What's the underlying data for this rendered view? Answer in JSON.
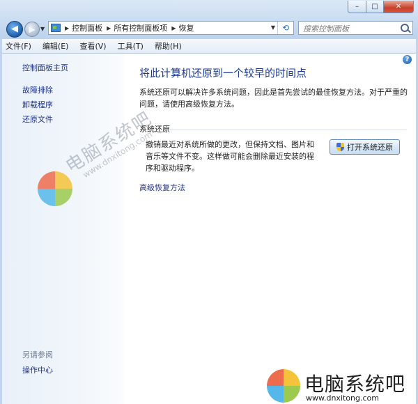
{
  "window": {
    "caption_min": "–",
    "caption_max": "□",
    "caption_close": "✕"
  },
  "address": {
    "crumbs": [
      "控制面板",
      "所有控制面板项",
      "恢复"
    ]
  },
  "search": {
    "placeholder": "搜索控制面板"
  },
  "menu": {
    "items": [
      "文件(F)",
      "编辑(E)",
      "查看(V)",
      "工具(T)",
      "帮助(H)"
    ]
  },
  "sidebar": {
    "home": "控制面板主页",
    "links": [
      "故障排除",
      "卸载程序",
      "还原文件"
    ],
    "see_also_header": "另请参阅",
    "see_also_links": [
      "操作中心"
    ]
  },
  "watermark": {
    "main": "电脑系统吧",
    "url": "www.dnxitong.com"
  },
  "content": {
    "title": "将此计算机还原到一个较早的时间点",
    "description": "系统还原可以解决许多系统问题，因此是首先尝试的最佳恢复方法。对于严重的问题，请使用高级恢复方法。",
    "section_header": "系统还原",
    "section_text": "撤销最近对系统所做的更改，但保持文档、图片和音乐等文件不变。这样做可能会删除最近安装的程序和驱动程序。",
    "open_button": "打开系统还原",
    "advanced_link": "高级恢复方法",
    "help": "?"
  },
  "brand": {
    "name": "电脑系统吧",
    "url": "www.dnxitong.com"
  },
  "colors": {
    "link": "#1e3287",
    "title": "#1e3a96",
    "logo_red": "#ee6c4e",
    "logo_yellow": "#f5c33a",
    "logo_blue": "#56b8ea",
    "logo_green": "#9cca4f"
  }
}
